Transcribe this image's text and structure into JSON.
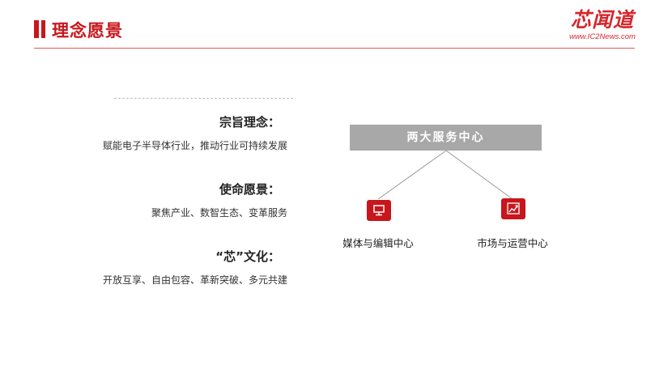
{
  "header": {
    "title": "理念愿景",
    "logo_text": "芯闻道",
    "logo_url": "www.IC2News.com"
  },
  "values": [
    {
      "title": "宗旨理念：",
      "text": "赋能电子半导体行业，推动行业可持续发展"
    },
    {
      "title": "使命愿景：",
      "text": "聚焦产业、数智生态、变革服务"
    },
    {
      "title": "“芯”文化：",
      "text": "开放互享、自由包容、革新突破、多元共建"
    }
  ],
  "services": {
    "title": "两大服务中心",
    "centers": [
      {
        "label": "媒体与编辑中心",
        "icon": "monitor-icon"
      },
      {
        "label": "市场与运营中心",
        "icon": "growth-chart-icon"
      }
    ]
  },
  "colors": {
    "accent": "#c8161d",
    "box_gray": "#a8a8a8",
    "rule": "#e25a5f"
  }
}
